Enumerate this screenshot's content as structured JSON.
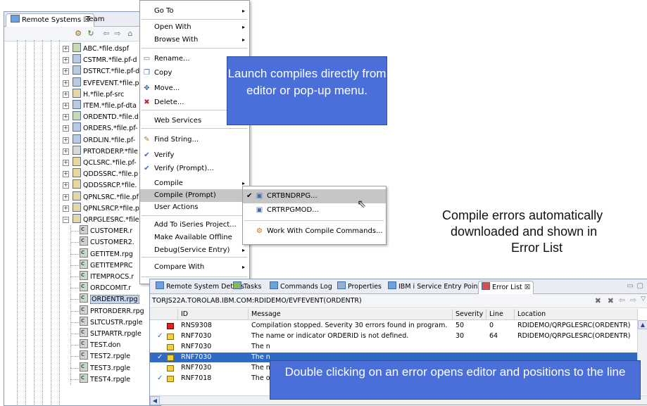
{
  "remote_systems": {
    "tab_label": "Remote Systems ☒",
    "tab2_label": "Team",
    "tree_items": [
      {
        "label": "ABC.*file.dspf",
        "icon": "display-file-icon"
      },
      {
        "label": "CSTMR.*file.pf-d",
        "icon": "file-icon"
      },
      {
        "label": "DSTRCT.*file.pf-d",
        "icon": "file-icon"
      },
      {
        "label": "EVFEVENT.*file.p",
        "icon": "file-icon"
      },
      {
        "label": "H.*file.pf-src",
        "icon": "source-file-icon"
      },
      {
        "label": "ITEM.*file.pf-dta",
        "icon": "file-icon"
      },
      {
        "label": "ORDENTD.*file.d",
        "icon": "display-file-icon"
      },
      {
        "label": "ORDERS.*file.pf-",
        "icon": "file-icon"
      },
      {
        "label": "ORDLIN.*file.pf-",
        "icon": "file-icon"
      },
      {
        "label": "PRTORDERP.*file",
        "icon": "printer-file-icon"
      },
      {
        "label": "QCLSRC.*file.pf-",
        "icon": "source-file-icon"
      },
      {
        "label": "QDDSSRC.*file.p",
        "icon": "source-file-icon"
      },
      {
        "label": "QDDSSRCP.*file.",
        "icon": "source-file-icon"
      },
      {
        "label": "QPNLSRC.*file.pf",
        "icon": "source-file-icon"
      },
      {
        "label": "QPNLSRCP.*file.p",
        "icon": "source-file-icon"
      },
      {
        "label": "QRPGLESRC.*file",
        "icon": "source-file-icon"
      }
    ],
    "members": [
      "CUSTOMER.r",
      "CUSTOMER2.",
      "GETITEM.rpg",
      "GETITEMPRC",
      "ITEMPROCS.r",
      "ORDCOMIT.r",
      "ORDENTR.rpg",
      "PRTORDERR.rpg",
      "SLTCUSTR.rpgle",
      "SLTPARTR.rpgle",
      "TEST.don",
      "TEST2.rpgle",
      "TEST3.rpgle",
      "TEST4.rpgle"
    ]
  },
  "menu": {
    "items": [
      {
        "label": "Go To",
        "arrow": "▸",
        "icon": ""
      },
      {
        "label": "Open With",
        "arrow": "▸",
        "icon": ""
      },
      {
        "label": "Browse With",
        "arrow": "▸",
        "icon": ""
      },
      {
        "label": "Rename...",
        "arrow": "",
        "icon": "rename-icon"
      },
      {
        "label": "Copy",
        "arrow": "",
        "icon": "copy-icon"
      },
      {
        "label": "Move...",
        "arrow": "",
        "icon": "move-icon"
      },
      {
        "label": "Delete...",
        "arrow": "",
        "icon": "delete-icon"
      },
      {
        "label": "Web Services",
        "arrow": "",
        "icon": ""
      },
      {
        "label": "Find String...",
        "arrow": "",
        "icon": "find-icon"
      },
      {
        "label": "Verify",
        "arrow": "",
        "icon": "verify-icon"
      },
      {
        "label": "Verify (Prompt)...",
        "arrow": "",
        "icon": "verify-prompt-icon"
      },
      {
        "label": "Compile",
        "arrow": "▸",
        "icon": ""
      },
      {
        "label": "Compile (Prompt)",
        "arrow": "▸",
        "icon": ""
      },
      {
        "label": "User Actions",
        "arrow": "▸",
        "icon": ""
      },
      {
        "label": "Add To iSeries Project...",
        "arrow": "",
        "icon": ""
      },
      {
        "label": "Make Available Offline",
        "arrow": "",
        "icon": ""
      },
      {
        "label": "Debug(Service Entry)",
        "arrow": "▸",
        "icon": ""
      },
      {
        "label": "Compare With",
        "arrow": "▸",
        "icon": ""
      }
    ]
  },
  "submenu": {
    "items": [
      {
        "label": "CRTBNDRPG...",
        "checked": "✔"
      },
      {
        "label": "CRTRPGMOD...",
        "checked": ""
      },
      {
        "label": "Work With Compile Commands...",
        "checked": ""
      }
    ]
  },
  "callout_top": "Launch compiles directly from editor or pop-up menu.",
  "callout_bottom": "Double clicking on an error opens editor and positions to the line",
  "note": {
    "line1": "Compile errors automatically",
    "line2": "downloaded and shown in",
    "line3": "Error List"
  },
  "bottom_panel": {
    "tabs": [
      "Remote System Details",
      "Tasks",
      "Commands Log",
      "Properties",
      "IBM i Service Entry Points",
      "Error List ☒"
    ],
    "path": "TORJS22A.TOROLAB.IBM.COM:RDIDEMO/EVFEVENT(ORDENTR)",
    "columns": [
      "ID",
      "Message",
      "Severity",
      "Line",
      "Location"
    ],
    "rows": [
      {
        "check": "",
        "sev": "error",
        "id": "RNS9308",
        "message": "Compilation stopped. Severity 30 errors found in program.",
        "severity": "50",
        "line": "0",
        "location": "RDIDEMO/QRPGLESRC(ORDENTR)"
      },
      {
        "check": "✓",
        "sev": "warning",
        "id": "RNF7030",
        "message": "The name or indicator ORDERID is not defined.",
        "severity": "30",
        "line": "64",
        "location": "RDIDEMO/QRPGLESRC(ORDENTR)"
      },
      {
        "check": "",
        "sev": "warning",
        "id": "RNF7030",
        "message": "The n",
        "severity": "",
        "line": "",
        "location": ""
      },
      {
        "check": "✓",
        "sev": "warning",
        "id": "RNF7030",
        "message": "The n",
        "severity": "",
        "line": "",
        "location": ""
      },
      {
        "check": "",
        "sev": "warning",
        "id": "RNF7030",
        "message": "The n",
        "severity": "",
        "line": "",
        "location": ""
      },
      {
        "check": "✓",
        "sev": "warning",
        "id": "RNF7018",
        "message": "The o",
        "severity": "",
        "line": "",
        "location": ""
      }
    ]
  }
}
